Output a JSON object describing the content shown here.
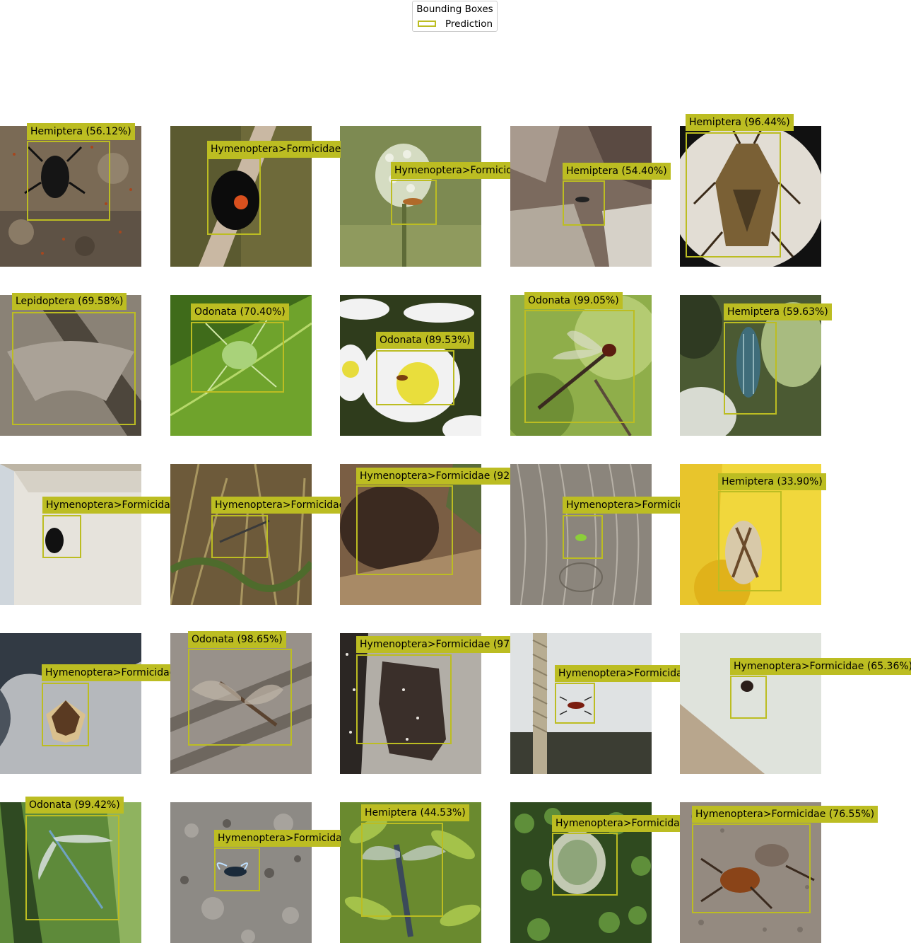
{
  "legend": {
    "title": "Bounding Boxes",
    "entry_label": "Prediction",
    "box_color": "#bcbd22"
  },
  "tiles": [
    {
      "label": "Hemiptera (56.12%)",
      "subject": "black beetle among ants on ground"
    },
    {
      "label": "Hymenoptera>Formicidae",
      "subject": "black ladybird with red spot on stem"
    },
    {
      "label": "Hymenoptera>Formicida",
      "subject": "small insect on wild carrot flower"
    },
    {
      "label": "Hemiptera (54.40%)",
      "subject": "small insect on leaf litter"
    },
    {
      "label": "Hemiptera (96.44%)",
      "subject": "brown stink bug"
    },
    {
      "label": "Lepidoptera (69.58%)",
      "subject": "grey moth on wood"
    },
    {
      "label": "Odonata (70.40%)",
      "subject": "green bug on leaf"
    },
    {
      "label": "Odonata (89.53%)",
      "subject": "small fly on daisy"
    },
    {
      "label": "Odonata (99.05%)",
      "subject": "dragonfly on twig"
    },
    {
      "label": "Hemiptera (59.63%)",
      "subject": "metallic beetle on plant"
    },
    {
      "label": "Hymenoptera>Formicidae",
      "subject": "black beetle in box"
    },
    {
      "label": "Hymenoptera>Formicidae",
      "subject": "damselfly in grass"
    },
    {
      "label": "Hymenoptera>Formicidae (92.",
      "subject": "ant mound"
    },
    {
      "label": "Hymenoptera>Formicid",
      "subject": "green larva on wood"
    },
    {
      "label": "Hemiptera (33.90%)",
      "subject": "bug on yellow flower"
    },
    {
      "label": "Hymenoptera>Formicidae",
      "subject": "moth with patterned wings"
    },
    {
      "label": "Odonata (98.65%)",
      "subject": "dragonfly on boards"
    },
    {
      "label": "Hymenoptera>Formicidae (97.",
      "subject": "ants on bark"
    },
    {
      "label": "Hymenoptera>Formicida",
      "subject": "ant near rope"
    },
    {
      "label": "Hymenoptera>Formicidae (65.36%)",
      "subject": "small insect on wall"
    },
    {
      "label": "Odonata (99.42%)",
      "subject": "damselfly on grass"
    },
    {
      "label": "Hymenoptera>Formicida",
      "subject": "insect on concrete"
    },
    {
      "label": "Hemiptera (44.53%)",
      "subject": "dragonfly on shrub"
    },
    {
      "label": "Hymenoptera>Formicida",
      "subject": "nest in bush"
    },
    {
      "label": "Hymenoptera>Formicidae (76.55%)",
      "subject": "ant on gravel"
    }
  ]
}
